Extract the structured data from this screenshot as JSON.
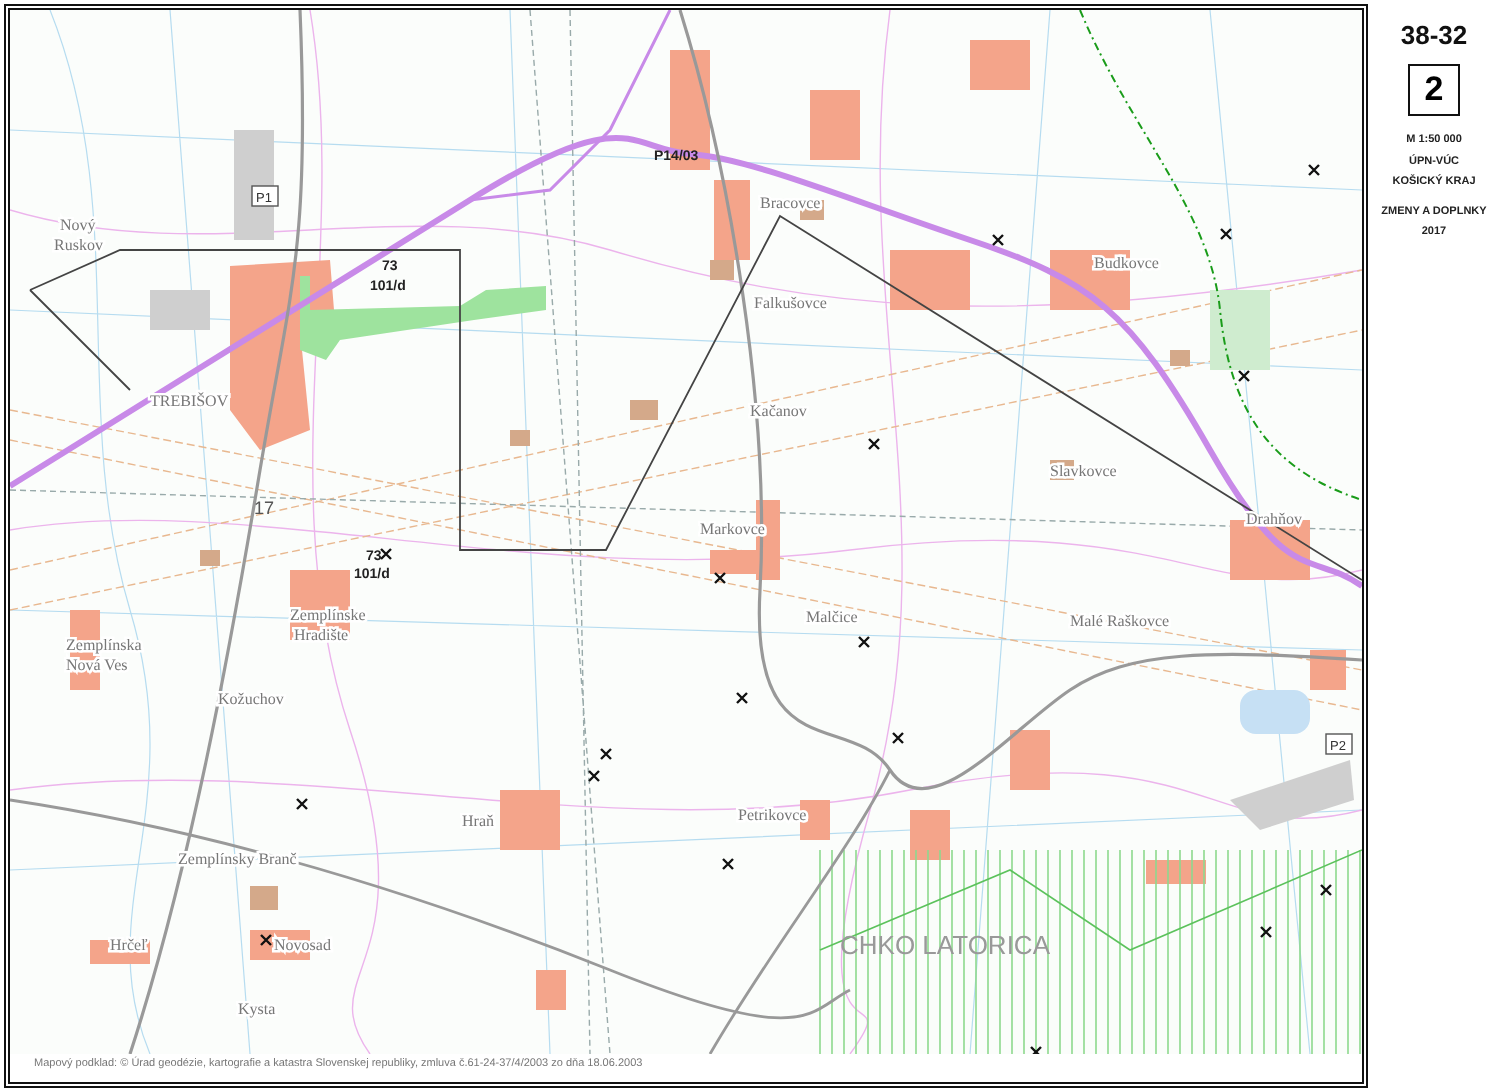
{
  "sheet": {
    "number": "38-32",
    "page": "2",
    "scale": "M 1:50 000",
    "plan": "ÚPN-VÚC",
    "region": "KOŠICKÝ KRAJ",
    "changes": "ZMENY A DOPLNKY",
    "year": "2017"
  },
  "map": {
    "labels": [
      {
        "text": "P14/03",
        "kind": "code"
      },
      {
        "text": "P1",
        "kind": "boxed"
      },
      {
        "text": "Bracovce",
        "kind": "town"
      },
      {
        "text": "Nový",
        "kind": "town"
      },
      {
        "text": "Ruskov",
        "kind": "town"
      },
      {
        "text": "Budkovce",
        "kind": "town"
      },
      {
        "text": "73",
        "kind": "code"
      },
      {
        "text": "101/d",
        "kind": "code"
      },
      {
        "text": "Falkušovce",
        "kind": "town"
      },
      {
        "text": "TREBIŠOV",
        "kind": "town"
      },
      {
        "text": "Kačanov",
        "kind": "town"
      },
      {
        "text": "Slavkovce",
        "kind": "town"
      },
      {
        "text": "17",
        "kind": "number"
      },
      {
        "text": "Drahňov",
        "kind": "town"
      },
      {
        "text": "Markovce",
        "kind": "town"
      },
      {
        "text": "73",
        "kind": "code"
      },
      {
        "text": "101/d",
        "kind": "code"
      },
      {
        "text": "Zemplínske",
        "kind": "town"
      },
      {
        "text": "Malčice",
        "kind": "town"
      },
      {
        "text": "Malé Raškovce",
        "kind": "town"
      },
      {
        "text": "Hradište",
        "kind": "town"
      },
      {
        "text": "Zemplínska",
        "kind": "town"
      },
      {
        "text": "Nová Ves",
        "kind": "town"
      },
      {
        "text": "Kožuchov",
        "kind": "town"
      },
      {
        "text": "P2",
        "kind": "boxed"
      },
      {
        "text": "Petrikovce",
        "kind": "town"
      },
      {
        "text": "Hraň",
        "kind": "town"
      },
      {
        "text": "Zemplínsky Branč",
        "kind": "town"
      },
      {
        "text": "Hrčeľ",
        "kind": "town"
      },
      {
        "text": "Novosad",
        "kind": "town"
      },
      {
        "text": "CHKO LATORICA",
        "kind": "area"
      },
      {
        "text": "Kysta",
        "kind": "town"
      }
    ],
    "credit": "Mapový podklad: © Úrad geodézie, kartografie a katastra Slovenskej republiky, zmluva č.61-24-37/4/2003 zo dňa 18.06.2003"
  }
}
